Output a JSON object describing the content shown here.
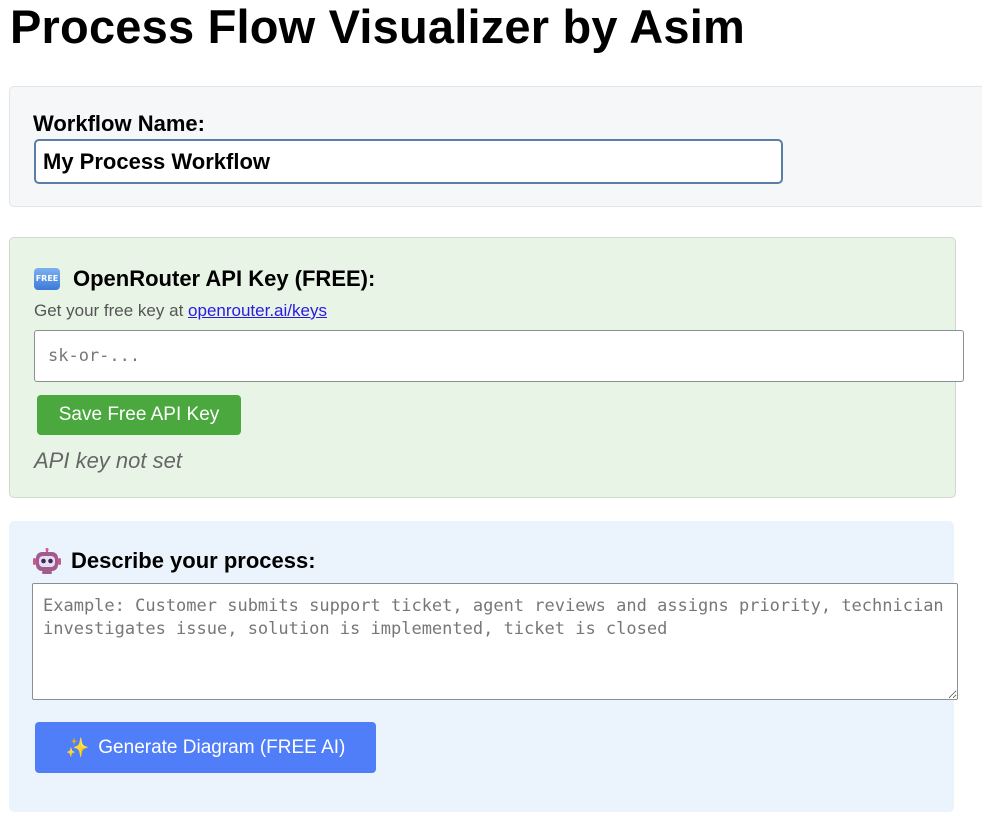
{
  "page": {
    "title": "Process Flow Visualizer by Asim"
  },
  "workflow": {
    "label": "Workflow Name:",
    "value": "My Process Workflow"
  },
  "api": {
    "title": "OpenRouter API Key (FREE):",
    "icon": "free-button-icon",
    "icon_text": "FREE",
    "hint_prefix": "Get your free key at",
    "hint_link": "openrouter.ai/keys",
    "input_placeholder": "sk-or-...",
    "input_value": "",
    "save_label": "Save Free API Key",
    "status": "API key not set",
    "accent_color": "#4aa83f"
  },
  "describe": {
    "title": "Describe your process:",
    "icon": "robot-icon",
    "textarea_placeholder": "Example: Customer submits support ticket, agent reviews and assigns priority, technician investigates issue, solution is implemented, ticket is closed",
    "textarea_value": "",
    "generate_label": "Generate Diagram (FREE AI)",
    "generate_icon": "sparkles-icon",
    "accent_color": "#4f7ef8"
  }
}
